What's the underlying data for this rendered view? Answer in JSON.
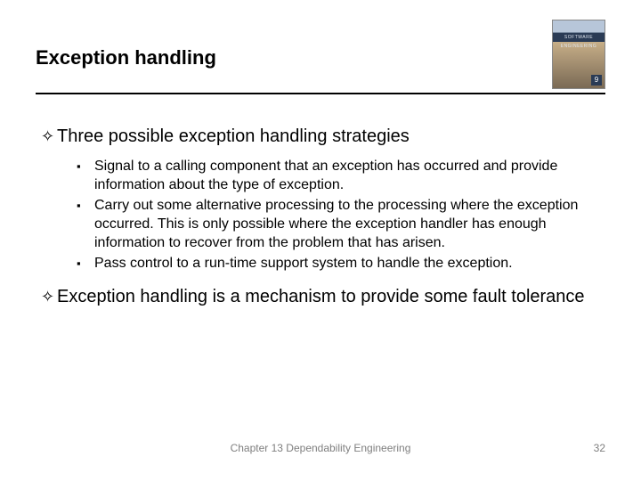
{
  "header": {
    "title": "Exception handling",
    "book_band": "SOFTWARE ENGINEERING",
    "edition": "9"
  },
  "points": [
    {
      "text": "Three possible exception handling strategies",
      "children": [
        {
          "text": "Signal to a calling component that an exception has occurred and provide information about the type of exception."
        },
        {
          "text": "Carry out some alternative processing to the processing where the exception occurred. This is only possible where the exception handler has enough information to recover from the problem that has arisen."
        },
        {
          "text": "Pass control to a run-time support system to handle the exception."
        }
      ]
    },
    {
      "text": "Exception handling is a mechanism to provide some fault tolerance",
      "children": []
    }
  ],
  "footer": {
    "center": "Chapter 13 Dependability Engineering",
    "page": "32"
  },
  "glyphs": {
    "lvl1": "✧",
    "lvl2": "▪"
  }
}
